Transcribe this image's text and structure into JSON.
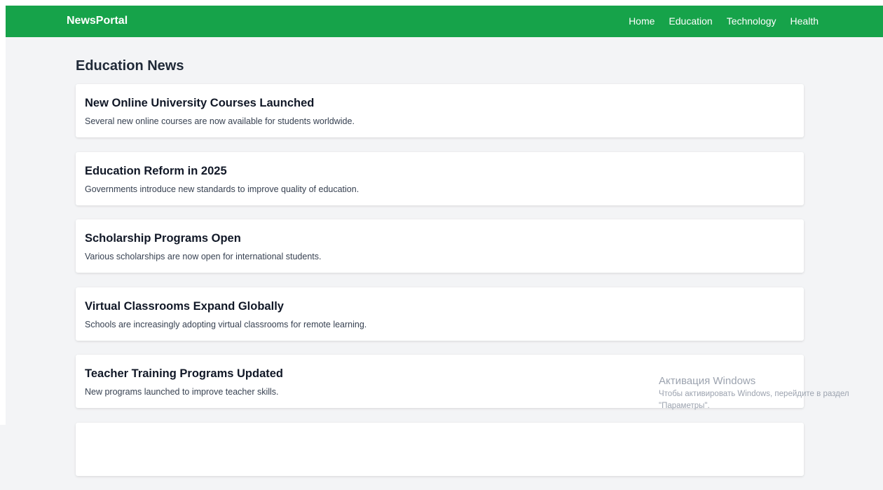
{
  "navbar": {
    "brand": "NewsPortal",
    "links": [
      "Home",
      "Education",
      "Technology",
      "Health"
    ],
    "color": "#16a34a"
  },
  "main": {
    "title": "Education News",
    "articles": [
      {
        "title": "New Online University Courses Launched",
        "summary": "Several new online courses are now available for students worldwide."
      },
      {
        "title": "Education Reform in 2025",
        "summary": "Governments introduce new standards to improve quality of education."
      },
      {
        "title": "Scholarship Programs Open",
        "summary": "Various scholarships are now open for international students."
      },
      {
        "title": "Virtual Classrooms Expand Globally",
        "summary": "Schools are increasingly adopting virtual classrooms for remote learning."
      },
      {
        "title": "Teacher Training Programs Updated",
        "summary": "New programs launched to improve teacher skills."
      },
      {
        "title": "",
        "summary": ""
      }
    ]
  },
  "watermark": {
    "title": "Активация Windows",
    "line1": "Чтобы активировать Windows, перейдите в раздел",
    "line2": "\"Параметры\"."
  }
}
